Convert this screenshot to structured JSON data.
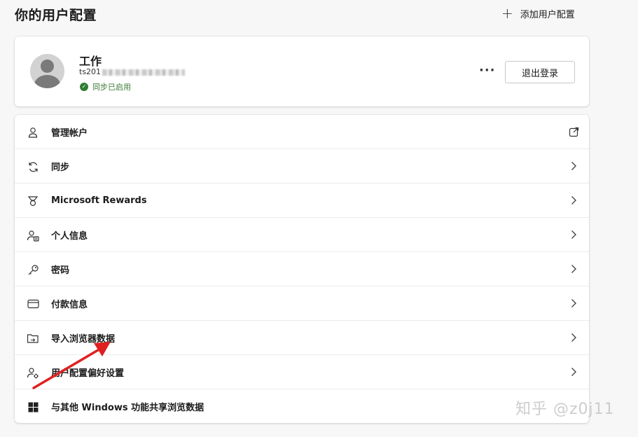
{
  "header": {
    "title": "你的用户配置",
    "add_profile_label": "添加用户配置",
    "add_icon": "plus-icon"
  },
  "profile": {
    "name": "工作",
    "email_prefix": "ts201",
    "sync_status": "同步已启用",
    "sync_icon": "check-circle-icon",
    "more_label": "···",
    "signout_label": "退出登录"
  },
  "menu": {
    "items": [
      {
        "label": "管理帐户",
        "icon": "person-icon",
        "trail": "external-link-icon"
      },
      {
        "label": "同步",
        "icon": "sync-icon",
        "trail": "chevron-right-icon"
      },
      {
        "label": "Microsoft Rewards",
        "icon": "rewards-medal-icon",
        "trail": "chevron-right-icon"
      },
      {
        "label": "个人信息",
        "icon": "personal-info-icon",
        "trail": "chevron-right-icon"
      },
      {
        "label": "密码",
        "icon": "key-icon",
        "trail": "chevron-right-icon"
      },
      {
        "label": "付款信息",
        "icon": "credit-card-icon",
        "trail": "chevron-right-icon"
      },
      {
        "label": "导入浏览器数据",
        "icon": "folder-import-icon",
        "trail": "chevron-right-icon"
      },
      {
        "label": "用户配置偏好设置",
        "icon": "person-settings-icon",
        "trail": "chevron-right-icon"
      },
      {
        "label": "与其他 Windows 功能共享浏览数据",
        "icon": "windows-logo-icon",
        "trail": ""
      }
    ]
  },
  "watermark": "知乎 @z0j11",
  "colors": {
    "background": "#f7f7f7",
    "card": "#ffffff",
    "sync_green": "#2f7d32",
    "annotation_red": "#e02020"
  }
}
